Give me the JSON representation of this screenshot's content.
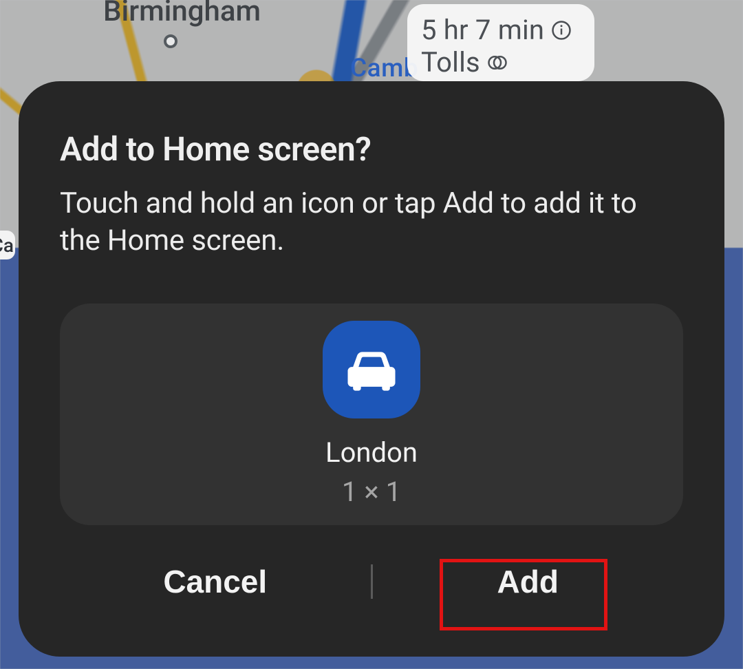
{
  "map": {
    "city_label": "Birmingham",
    "partial_label": "Camb",
    "edge_label": "Ca",
    "route_info": {
      "duration": "5 hr 7 min",
      "condition": "Tolls"
    }
  },
  "dialog": {
    "title": "Add to Home screen?",
    "description": "Touch and hold an icon or tap Add to add it to the Home screen.",
    "shortcut": {
      "name": "London",
      "size": "1 × 1",
      "icon": "car-icon"
    },
    "buttons": {
      "cancel": "Cancel",
      "add": "Add"
    }
  }
}
